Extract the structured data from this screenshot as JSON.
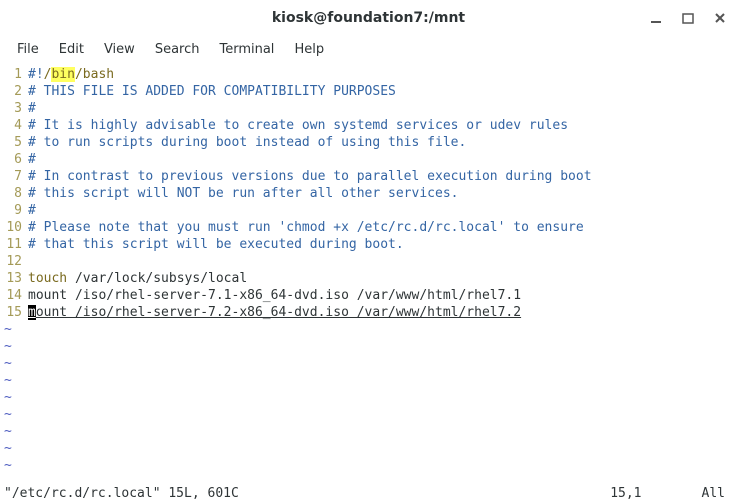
{
  "window": {
    "title": "kiosk@foundation7:/mnt"
  },
  "menu": {
    "file": "File",
    "edit": "Edit",
    "view": "View",
    "search": "Search",
    "terminal": "Terminal",
    "help": "Help"
  },
  "editor": {
    "lines": {
      "l1_num": "1",
      "l1_hash": "#!",
      "l1_slash1": "/",
      "l1_bin": "bin",
      "l1_rest": "/bash",
      "l2_num": "2",
      "l2_text": "# THIS FILE IS ADDED FOR COMPATIBILITY PURPOSES",
      "l3_num": "3",
      "l3_text": "#",
      "l4_num": "4",
      "l4_text": "# It is highly advisable to create own systemd services or udev rules",
      "l5_num": "5",
      "l5_text": "# to run scripts during boot instead of using this file.",
      "l6_num": "6",
      "l6_text": "#",
      "l7_num": "7",
      "l7_text": "# In contrast to previous versions due to parallel execution during boot",
      "l8_num": "8",
      "l8_text": "# this script will NOT be run after all other services.",
      "l9_num": "9",
      "l9_text": "#",
      "l10_num": "10",
      "l10_text": "# Please note that you must run 'chmod +x /etc/rc.d/rc.local' to ensure",
      "l11_num": "11",
      "l11_text": "# that this script will be executed during boot.",
      "l12_num": "12",
      "l12_text": "",
      "l13_num": "13",
      "l13_touch": "touch",
      "l13_rest": " /var/lock/subsys/local",
      "l14_num": "14",
      "l14_text": "mount /iso/rhel-server-7.1-x86_64-dvd.iso /var/www/html/rhel7.1",
      "l15_num": "15",
      "l15_cursor": "m",
      "l15_rest": "ount /iso/rhel-server-7.2-x86_64-dvd.iso /var/www/html/rhel7.2"
    },
    "tilde": "~"
  },
  "statusbar": {
    "file": "\"/etc/rc.d/rc.local\" 15L, 601C",
    "position": "15,1",
    "scroll": "All"
  }
}
